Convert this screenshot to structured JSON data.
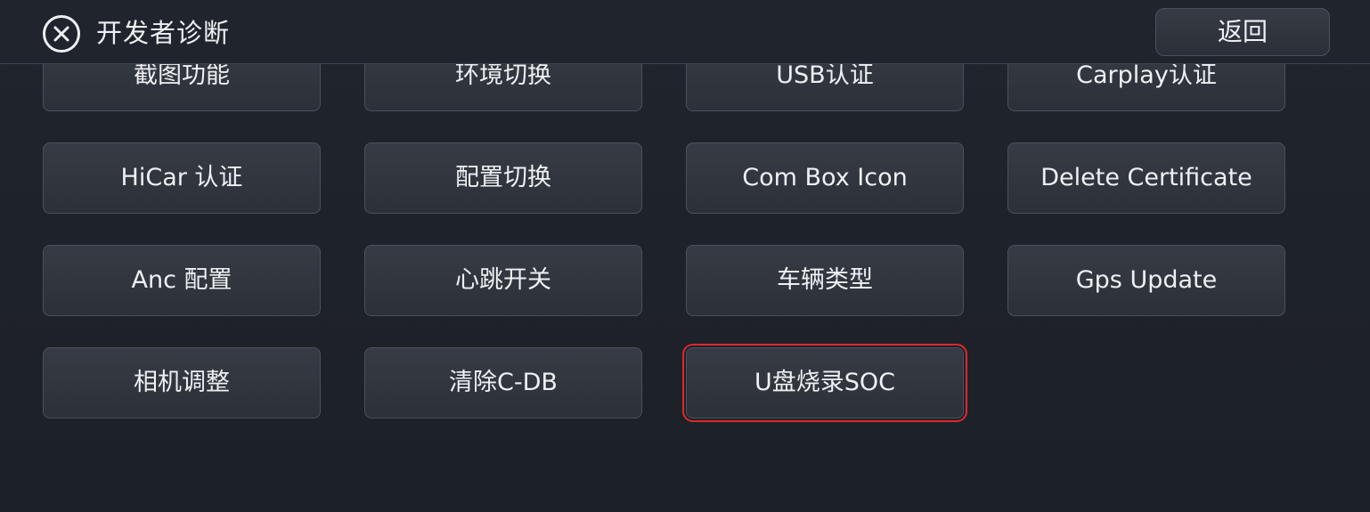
{
  "header": {
    "title": "开发者诊断",
    "back_label": "返回",
    "close_icon": "close-circle-icon"
  },
  "grid": {
    "rows": [
      [
        "截图功能",
        "环境切换",
        "USB认证",
        "Carplay认证"
      ],
      [
        "HiCar 认证",
        "配置切换",
        "Com Box Icon",
        "Delete Certificate"
      ],
      [
        "Anc 配置",
        "心跳开关",
        "车辆类型",
        "Gps Update"
      ],
      [
        "相机调整",
        "清除C-DB",
        "U盘烧录SOC"
      ]
    ],
    "selected_item": "U盘烧录SOC"
  },
  "colors": {
    "background": "#1f232b",
    "tile": "#323741",
    "tile_border": "#4b515a",
    "text": "#eef0f3",
    "selection": "#e0282d"
  }
}
